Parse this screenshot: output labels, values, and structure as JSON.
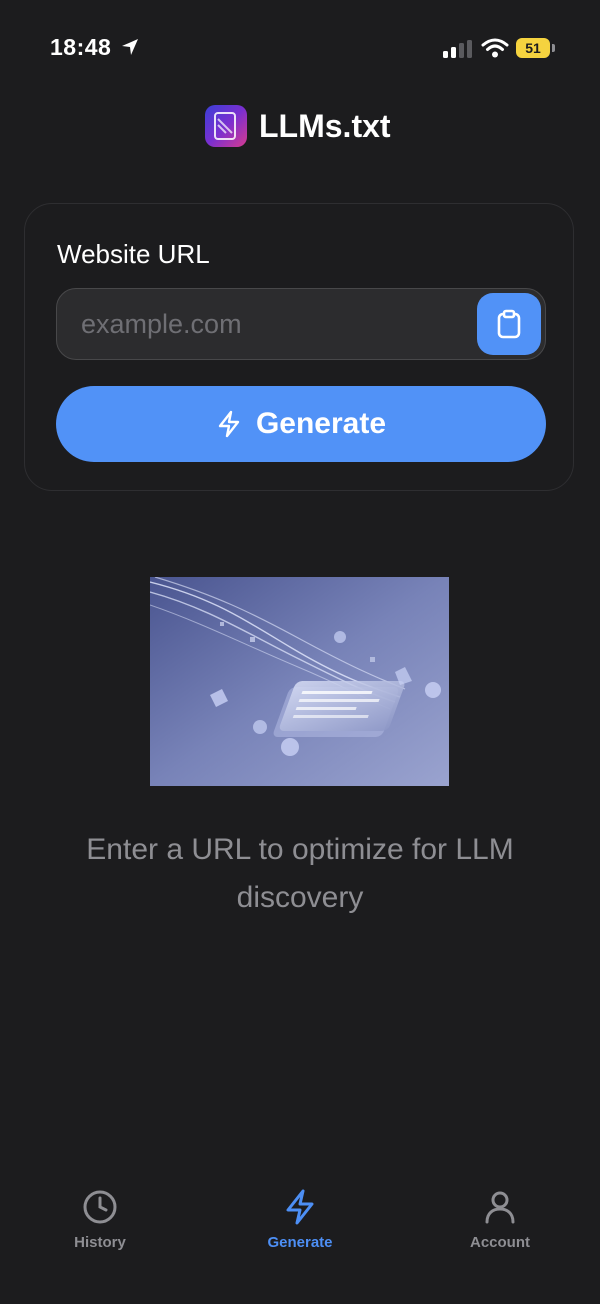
{
  "status_bar": {
    "time": "18:48",
    "battery_level": "51",
    "battery_color": "#f5d33f"
  },
  "header": {
    "title": "LLMs.txt",
    "logo_icon": "document-logo-icon"
  },
  "form": {
    "label": "Website URL",
    "url_placeholder": "example.com",
    "url_value": "",
    "paste_icon": "clipboard-icon",
    "generate_label": "Generate",
    "generate_icon": "lightning-icon"
  },
  "empty_state": {
    "message": "Enter a URL to optimize for LLM discovery"
  },
  "tab_bar": {
    "tabs": [
      {
        "label": "History",
        "icon": "clock-icon",
        "active": false
      },
      {
        "label": "Generate",
        "icon": "lightning-icon",
        "active": true
      },
      {
        "label": "Account",
        "icon": "person-icon",
        "active": false
      }
    ]
  },
  "colors": {
    "background": "#1c1c1e",
    "accent": "#5192f7",
    "active_tab": "#4d8ff5",
    "muted_text": "#8e8e93"
  }
}
